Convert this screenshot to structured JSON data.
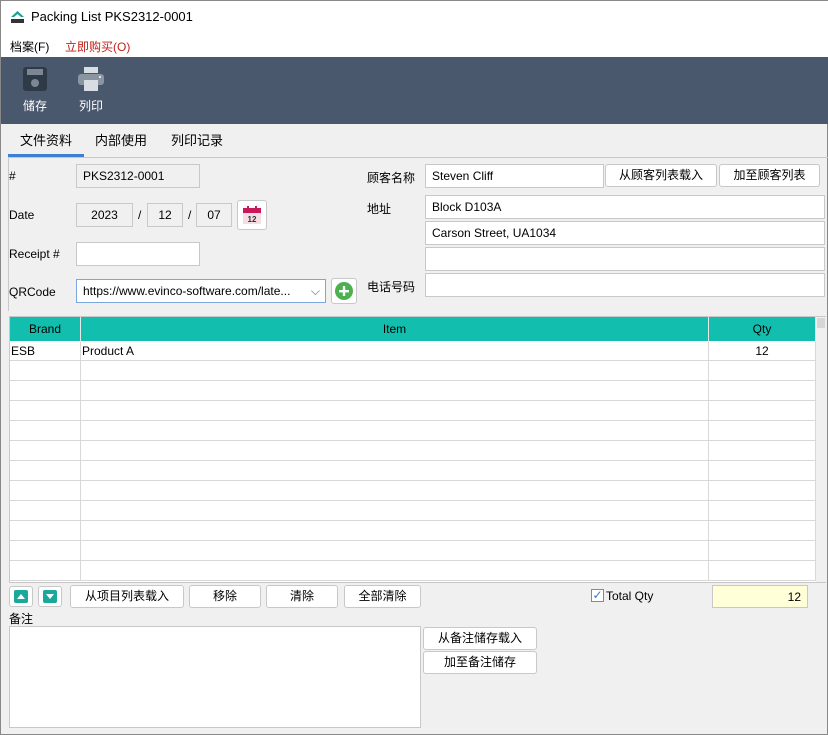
{
  "window": {
    "title": "Packing List PKS2312-0001"
  },
  "menu": {
    "file": "档案(F)",
    "buy": "立即购买(O)"
  },
  "toolbar": {
    "save": "储存",
    "print": "列印"
  },
  "tabs": [
    {
      "label": "文件资料",
      "active": true
    },
    {
      "label": "内部使用"
    },
    {
      "label": "列印记录"
    }
  ],
  "form": {
    "number_label": "#",
    "number": "PKS2312-0001",
    "date_label": "Date",
    "year": "2023",
    "month": "12",
    "day": "07",
    "sep": "/",
    "receipt_label": "Receipt #",
    "receipt": "",
    "qrcode_label": "QRCode",
    "qrcode": "https://www.evinco-software.com/late...",
    "customer_label": "顾客名称",
    "customer": "Steven Cliff",
    "load_customer": "从顾客列表载入",
    "add_customer": "加至顾客列表",
    "address_label": "地址",
    "address": [
      "Block D103A",
      "Carson Street, UA1034",
      "",
      ""
    ],
    "phone_label": "电话号码",
    "phone": ""
  },
  "grid": {
    "columns": [
      "Brand",
      "Item",
      "Qty"
    ],
    "rows": [
      [
        "ESB",
        "Product A",
        "12"
      ]
    ],
    "header_color": "#12bfae"
  },
  "actions": {
    "load_items": "从项目列表载入",
    "remove": "移除",
    "clear": "清除",
    "clear_all": "全部清除",
    "total_qty_label": "Total Qty",
    "total_qty_checked": true,
    "total_qty": "12"
  },
  "notes": {
    "label": "备注",
    "value": "",
    "load": "从备注储存载入",
    "add": "加至备注储存"
  }
}
